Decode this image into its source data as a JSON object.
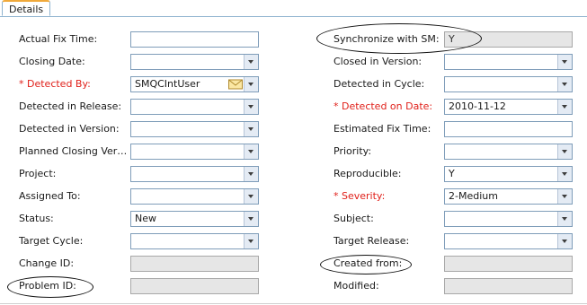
{
  "tab": {
    "label": "Details"
  },
  "left": [
    {
      "label": "Actual Fix Time:",
      "required": false,
      "type": "text",
      "value": ""
    },
    {
      "label": "Closing Date:",
      "required": false,
      "type": "select",
      "value": ""
    },
    {
      "label": "* Detected By:",
      "required": true,
      "type": "user",
      "value": "SMQCIntUser"
    },
    {
      "label": "Detected in Release:",
      "required": false,
      "type": "select",
      "value": ""
    },
    {
      "label": "Detected in Version:",
      "required": false,
      "type": "select",
      "value": ""
    },
    {
      "label": "Planned Closing Ver…",
      "required": false,
      "type": "select",
      "value": ""
    },
    {
      "label": "Project:",
      "required": false,
      "type": "select",
      "value": ""
    },
    {
      "label": "Assigned To:",
      "required": false,
      "type": "select",
      "value": ""
    },
    {
      "label": "Status:",
      "required": false,
      "type": "select",
      "value": "New"
    },
    {
      "label": "Target Cycle:",
      "required": false,
      "type": "select",
      "value": ""
    },
    {
      "label": "Change ID:",
      "required": false,
      "type": "readonly",
      "value": ""
    },
    {
      "label": "Problem ID:",
      "required": false,
      "type": "readonly",
      "value": ""
    }
  ],
  "right": [
    {
      "label": "Synchronize with SM:",
      "required": false,
      "type": "readonly",
      "value": "Y"
    },
    {
      "label": "Closed in Version:",
      "required": false,
      "type": "select",
      "value": ""
    },
    {
      "label": "Detected in Cycle:",
      "required": false,
      "type": "select",
      "value": ""
    },
    {
      "label": "* Detected on Date:",
      "required": true,
      "type": "select",
      "value": "2010-11-12"
    },
    {
      "label": "Estimated Fix Time:",
      "required": false,
      "type": "text",
      "value": ""
    },
    {
      "label": "Priority:",
      "required": false,
      "type": "select",
      "value": ""
    },
    {
      "label": "Reproducible:",
      "required": false,
      "type": "select",
      "value": "Y"
    },
    {
      "label": "* Severity:",
      "required": true,
      "type": "select",
      "value": "2-Medium"
    },
    {
      "label": "Subject:",
      "required": false,
      "type": "select",
      "value": ""
    },
    {
      "label": "Target Release:",
      "required": false,
      "type": "select",
      "value": ""
    },
    {
      "label": "Created from:",
      "required": false,
      "type": "readonly",
      "value": ""
    },
    {
      "label": "Modified:",
      "required": false,
      "type": "readonly",
      "value": ""
    }
  ],
  "icons": {
    "mail": "envelope-icon",
    "dropdown": "chevron-down-icon"
  },
  "colors": {
    "required": "#e0201a",
    "tab_accent": "#f0a93b",
    "readonly_bg": "#e6e6e6"
  }
}
